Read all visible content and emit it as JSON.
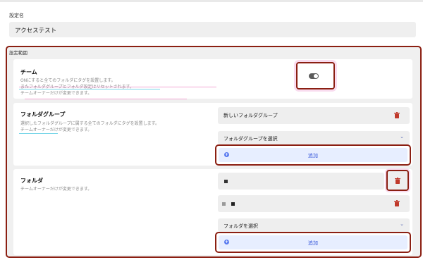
{
  "settings_name": {
    "label": "設定名",
    "value": "アクセステスト"
  },
  "scope": {
    "label": "設定範囲",
    "team": {
      "title": "チーム",
      "description": "ONにすると全てのフォルダにタグを設置します。\nまたフォルダグループとフォルダ設定はリセットされます。\nチームオーナーだけが変更できます。",
      "toggle_state": "off"
    },
    "folder_group": {
      "title": "フォルダグループ",
      "description": "選択したフォルダグループに属する全てのフォルダにタグを設置します。\nチームオーナーだけが変更できます。",
      "items": [
        "新しいフォルダグループ"
      ],
      "select_placeholder": "フォルダグループを選択",
      "add_label": "追加"
    },
    "folder": {
      "title": "フォルダ",
      "description": "チームオーナーだけが変更できます。",
      "select_placeholder": "フォルダを選択",
      "add_label": "追加"
    }
  },
  "colors": {
    "accent": "#3b5bdb",
    "highlight_border": "#8b1f12",
    "trash": "#c0392b"
  },
  "icons": {
    "trash": "trash-icon",
    "chevron": "chevron-down-icon",
    "plus": "plus-circle-icon"
  }
}
